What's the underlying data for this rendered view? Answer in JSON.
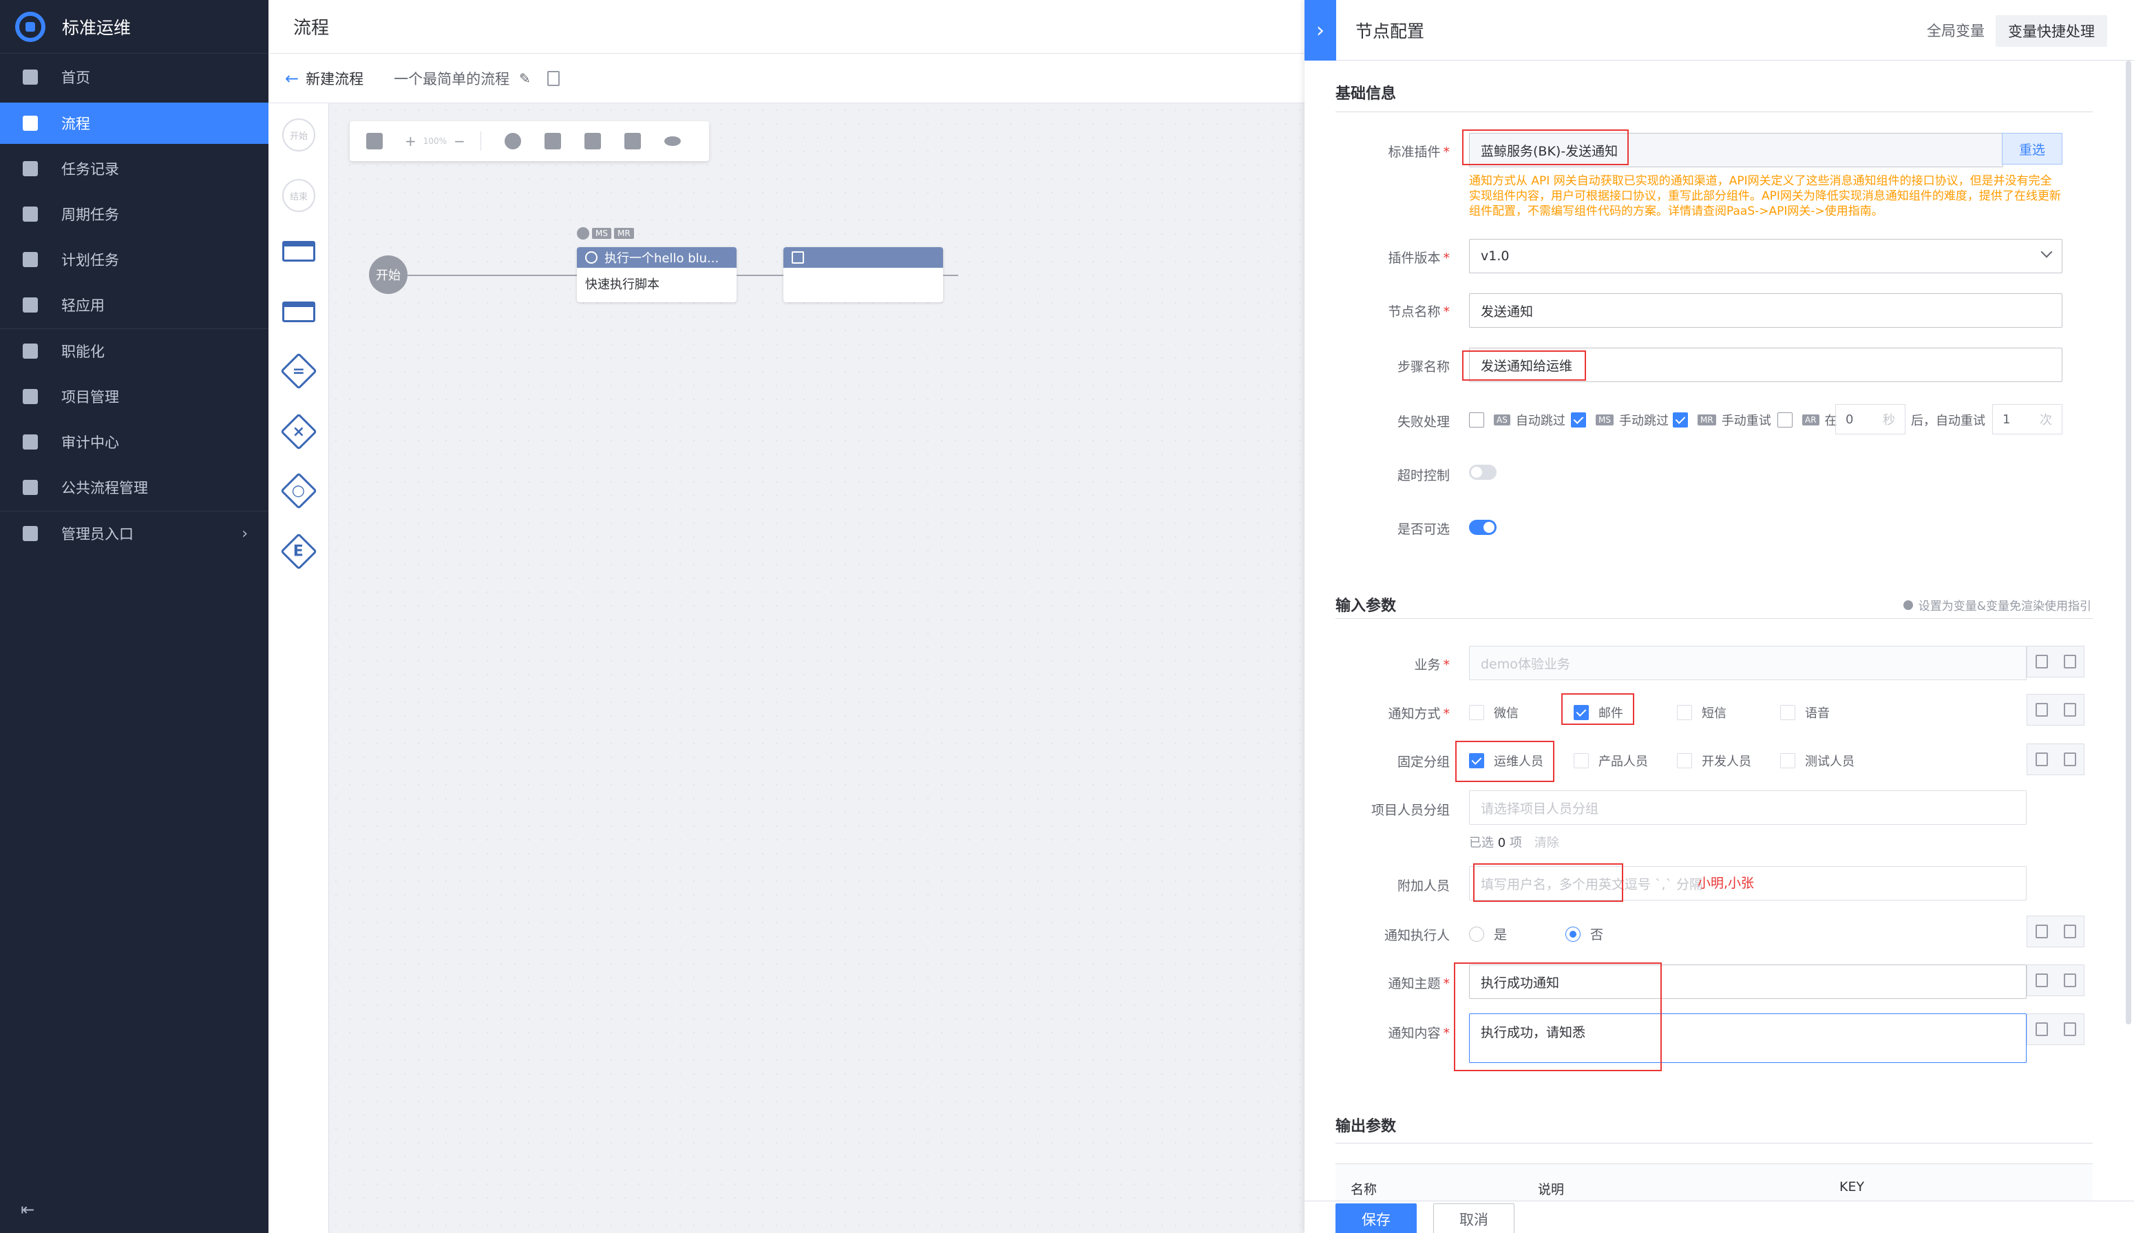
{
  "app": {
    "name": "标准运维"
  },
  "sidebar": {
    "items": [
      {
        "label": "首页",
        "icon": "home-icon"
      },
      {
        "label": "流程",
        "icon": "flow-icon",
        "active": true
      },
      {
        "label": "任务记录",
        "icon": "bookmark-icon"
      },
      {
        "label": "周期任务",
        "icon": "calendar-icon"
      },
      {
        "label": "计划任务",
        "icon": "plan-icon"
      },
      {
        "label": "轻应用",
        "icon": "grid-icon"
      },
      {
        "label": "职能化",
        "icon": "function-icon"
      },
      {
        "label": "项目管理",
        "icon": "project-icon"
      },
      {
        "label": "审计中心",
        "icon": "audit-icon"
      },
      {
        "label": "公共流程管理",
        "icon": "public-flow-icon"
      },
      {
        "label": "管理员入口",
        "icon": "admin-icon"
      }
    ],
    "admin_arrow": "›",
    "collapse": "⇤"
  },
  "header": {
    "title": "流程"
  },
  "subheader": {
    "back_label": "新建流程",
    "flow_name": "一个最简单的流程"
  },
  "palette": {
    "start": "开始",
    "end": "结束"
  },
  "toolbar": {
    "zoom": "100%"
  },
  "canvas": {
    "start_node": "开始",
    "task_node": {
      "title": "执行一个hello blu...",
      "body": "快速执行脚本",
      "tags": [
        "MS",
        "MR"
      ]
    }
  },
  "panel": {
    "title": "节点配置",
    "global_vars": "全局变量",
    "quick_vars": "变量快捷处理",
    "basic_section": "基础信息",
    "plugin": {
      "label": "标准插件",
      "value": "蓝鲸服务(BK)-发送通知",
      "reselect": "重选"
    },
    "note": "通知方式从 API 网关自动获取已实现的通知渠道，API网关定义了这些消息通知组件的接口协议，但是并没有完全实现组件内容，用户可根据接口协议，重写此部分组件。API网关为降低实现消息通知组件的难度，提供了在线更新组件配置，不需编写组件代码的方案。详情请查阅PaaS->API网关->使用指南。",
    "version": {
      "label": "插件版本",
      "value": "v1.0"
    },
    "node_name": {
      "label": "节点名称",
      "value": "发送通知"
    },
    "step_name": {
      "label": "步骤名称",
      "value": "发送通知给运维"
    },
    "fail": {
      "label": "失败处理",
      "auto_skip": {
        "badge": "AS",
        "text": "自动跳过"
      },
      "manual_skip": {
        "badge": "MS",
        "text": "手动跳过"
      },
      "manual_retry": {
        "badge": "MR",
        "text": "手动重试"
      },
      "auto_retry": {
        "badge": "AR",
        "prefix": "在",
        "seconds": "0",
        "sec_unit": "秒",
        "after": "后，自动重试",
        "times": "1",
        "times_unit": "次"
      }
    },
    "timeout": {
      "label": "超时控制"
    },
    "optional": {
      "label": "是否可选"
    },
    "input_section": "输入参数",
    "input_hint": "设置为变量&变量免渲染使用指引",
    "biz": {
      "label": "业务",
      "placeholder": "demo体验业务"
    },
    "notify_type": {
      "label": "通知方式",
      "options": [
        "微信",
        "邮件",
        "短信",
        "语音"
      ]
    },
    "fixed_group": {
      "label": "固定分组",
      "options": [
        "运维人员",
        "产品人员",
        "开发人员",
        "测试人员"
      ]
    },
    "project_group": {
      "label": "项目人员分组",
      "placeholder": "请选择项目人员分组",
      "selected_prefix": "已选",
      "selected_count": "0",
      "selected_suffix": "项",
      "clear": "清除"
    },
    "extra_users": {
      "label": "附加人员",
      "placeholder": "填写用户名，多个用英文逗号 `,` 分隔",
      "annotation": "小明,小张"
    },
    "notify_executor": {
      "label": "通知执行人",
      "yes": "是",
      "no": "否"
    },
    "subject": {
      "label": "通知主题",
      "value": "执行成功通知"
    },
    "content": {
      "label": "通知内容",
      "value": "执行成功，请知悉"
    },
    "output_section": "输出参数",
    "output_cols": [
      "名称",
      "说明",
      "KEY"
    ],
    "save": "保存",
    "cancel": "取消"
  }
}
